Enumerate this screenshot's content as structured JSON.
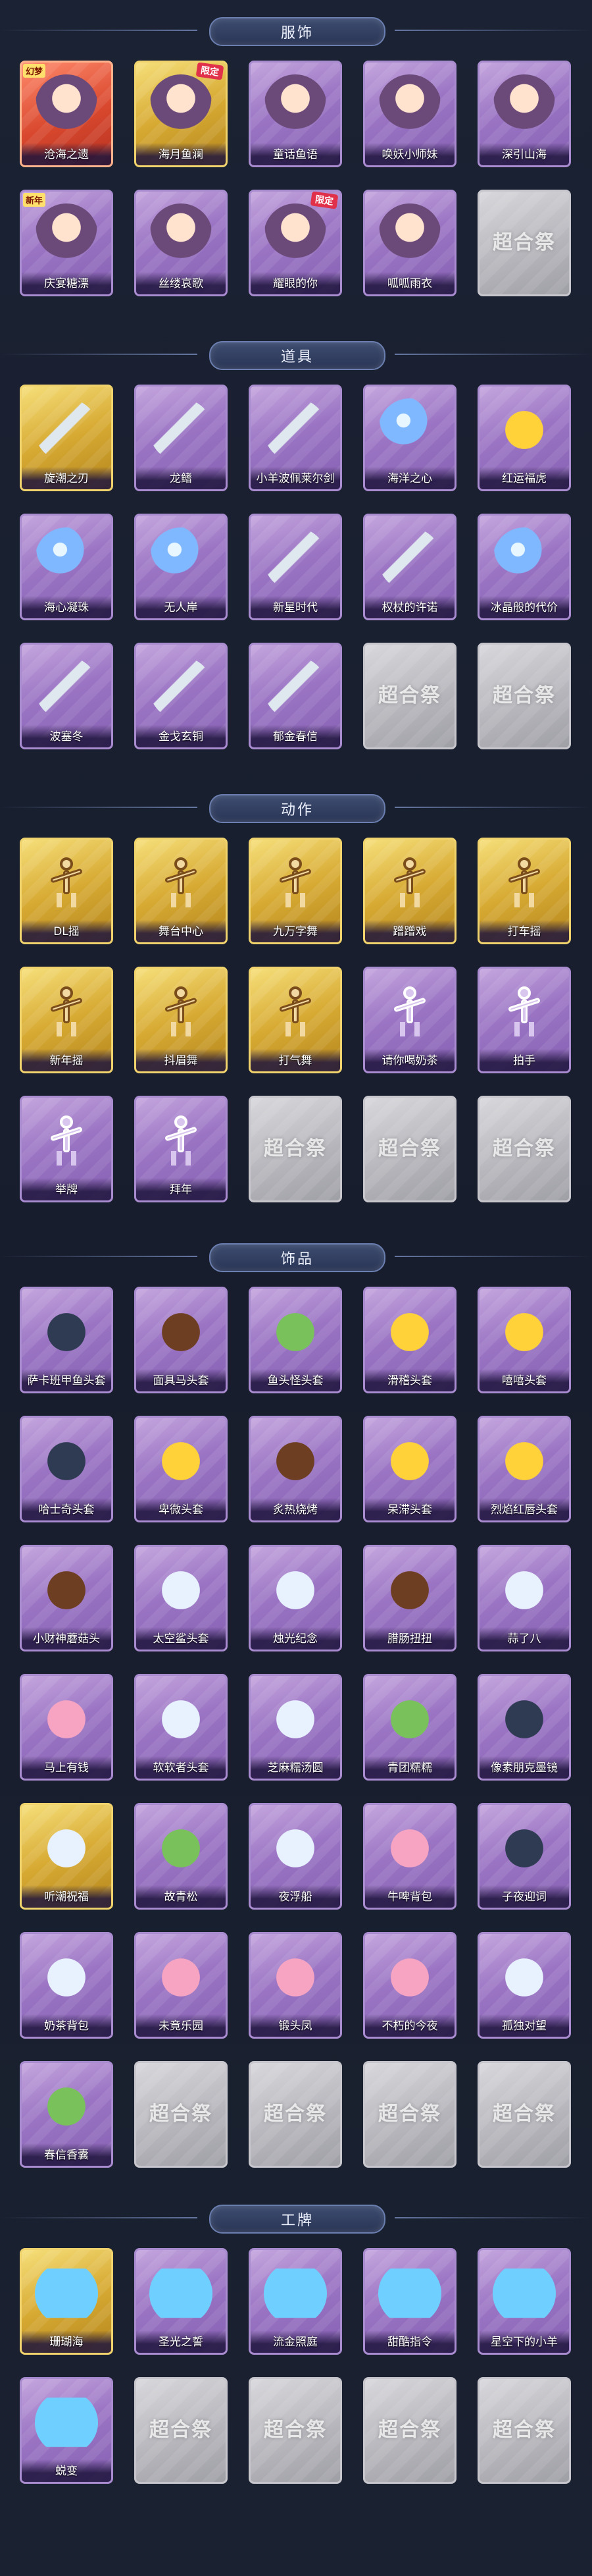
{
  "sections": [
    {
      "title": "服饰",
      "items": [
        {
          "name": "沧海之遗",
          "rarity": "red",
          "art": "portrait",
          "tag": "幻梦",
          "badge": ""
        },
        {
          "name": "海月鱼澜",
          "rarity": "gold",
          "art": "portrait",
          "tag": "",
          "badge": "限定"
        },
        {
          "name": "童话鱼语",
          "rarity": "purple",
          "art": "portrait",
          "tag": "",
          "badge": ""
        },
        {
          "name": "唤妖小师妹",
          "rarity": "purple",
          "art": "portrait",
          "tag": "",
          "badge": ""
        },
        {
          "name": "深引山海",
          "rarity": "purple",
          "art": "portrait",
          "tag": "",
          "badge": ""
        },
        {
          "name": "庆宴糖漂",
          "rarity": "purple",
          "art": "portrait",
          "tag": "新年",
          "badge": ""
        },
        {
          "name": "丝缕哀歌",
          "rarity": "purple",
          "art": "portrait",
          "tag": "",
          "badge": ""
        },
        {
          "name": "耀眼的你",
          "rarity": "purple",
          "art": "portrait",
          "tag": "",
          "badge": "限定"
        },
        {
          "name": "呱呱雨衣",
          "rarity": "purple",
          "art": "portrait",
          "tag": "",
          "badge": ""
        },
        {
          "name": "",
          "rarity": "locked",
          "art": "",
          "tag": "",
          "badge": ""
        }
      ]
    },
    {
      "title": "道具",
      "items": [
        {
          "name": "旋潮之刃",
          "rarity": "gold",
          "art": "tool",
          "tag": "",
          "badge": ""
        },
        {
          "name": "龙鳍",
          "rarity": "purple",
          "art": "tool",
          "tag": "",
          "badge": ""
        },
        {
          "name": "小羊波佩莱尔剑",
          "rarity": "purple",
          "art": "tool",
          "tag": "",
          "badge": ""
        },
        {
          "name": "海洋之心",
          "rarity": "purple",
          "art": "gem",
          "tag": "",
          "badge": ""
        },
        {
          "name": "红运福虎",
          "rarity": "purple",
          "art": "head",
          "tag": "",
          "badge": ""
        },
        {
          "name": "海心凝珠",
          "rarity": "purple",
          "art": "gem",
          "tag": "",
          "badge": ""
        },
        {
          "name": "无人岸",
          "rarity": "purple",
          "art": "gem",
          "tag": "",
          "badge": ""
        },
        {
          "name": "新星时代",
          "rarity": "purple",
          "art": "tool",
          "tag": "",
          "badge": ""
        },
        {
          "name": "权杖的许诺",
          "rarity": "purple",
          "art": "tool",
          "tag": "",
          "badge": ""
        },
        {
          "name": "冰晶般的代价",
          "rarity": "purple",
          "art": "gem",
          "tag": "",
          "badge": ""
        },
        {
          "name": "波塞冬",
          "rarity": "purple",
          "art": "tool",
          "tag": "",
          "badge": ""
        },
        {
          "name": "金戈玄铜",
          "rarity": "purple",
          "art": "tool",
          "tag": "",
          "badge": ""
        },
        {
          "name": "郁金春信",
          "rarity": "purple",
          "art": "tool",
          "tag": "",
          "badge": ""
        },
        {
          "name": "",
          "rarity": "locked",
          "art": "",
          "tag": "",
          "badge": ""
        },
        {
          "name": "",
          "rarity": "locked",
          "art": "",
          "tag": "",
          "badge": ""
        }
      ]
    },
    {
      "title": "动作",
      "items": [
        {
          "name": "DL摇",
          "rarity": "gold",
          "art": "pose",
          "tag": "",
          "badge": ""
        },
        {
          "name": "舞台中心",
          "rarity": "gold",
          "art": "pose",
          "tag": "",
          "badge": ""
        },
        {
          "name": "九万字舞",
          "rarity": "gold",
          "art": "pose",
          "tag": "",
          "badge": ""
        },
        {
          "name": "蹭蹭戏",
          "rarity": "gold",
          "art": "pose",
          "tag": "",
          "badge": ""
        },
        {
          "name": "打车摇",
          "rarity": "gold",
          "art": "pose",
          "tag": "",
          "badge": ""
        },
        {
          "name": "新年摇",
          "rarity": "gold",
          "art": "pose",
          "tag": "",
          "badge": ""
        },
        {
          "name": "抖眉舞",
          "rarity": "gold",
          "art": "pose",
          "tag": "",
          "badge": ""
        },
        {
          "name": "打气舞",
          "rarity": "gold",
          "art": "pose",
          "tag": "",
          "badge": ""
        },
        {
          "name": "请你喝奶茶",
          "rarity": "purple",
          "art": "pose",
          "tag": "",
          "badge": ""
        },
        {
          "name": "拍手",
          "rarity": "purple",
          "art": "pose",
          "tag": "",
          "badge": ""
        },
        {
          "name": "举牌",
          "rarity": "purple",
          "art": "pose",
          "tag": "",
          "badge": ""
        },
        {
          "name": "拜年",
          "rarity": "purple",
          "art": "pose",
          "tag": "",
          "badge": ""
        },
        {
          "name": "",
          "rarity": "locked",
          "art": "",
          "tag": "",
          "badge": ""
        },
        {
          "name": "",
          "rarity": "locked",
          "art": "",
          "tag": "",
          "badge": ""
        },
        {
          "name": "",
          "rarity": "locked",
          "art": "",
          "tag": "",
          "badge": ""
        }
      ]
    },
    {
      "title": "饰品",
      "items": [
        {
          "name": "萨卡班甲鱼头套",
          "rarity": "purple",
          "art": "dark",
          "tag": "",
          "badge": ""
        },
        {
          "name": "面具马头套",
          "rarity": "purple",
          "art": "brown",
          "tag": "",
          "badge": ""
        },
        {
          "name": "鱼头怪头套",
          "rarity": "purple",
          "art": "green",
          "tag": "",
          "badge": ""
        },
        {
          "name": "滑稽头套",
          "rarity": "purple",
          "art": "head",
          "tag": "",
          "badge": ""
        },
        {
          "name": "嘻嘻头套",
          "rarity": "purple",
          "art": "head",
          "tag": "",
          "badge": ""
        },
        {
          "name": "哈士奇头套",
          "rarity": "purple",
          "art": "dark",
          "tag": "",
          "badge": ""
        },
        {
          "name": "卑微头套",
          "rarity": "purple",
          "art": "head",
          "tag": "",
          "badge": ""
        },
        {
          "name": "炙热烧烤",
          "rarity": "purple",
          "art": "brown",
          "tag": "",
          "badge": ""
        },
        {
          "name": "呆滞头套",
          "rarity": "purple",
          "art": "head",
          "tag": "",
          "badge": ""
        },
        {
          "name": "烈焰红唇头套",
          "rarity": "purple",
          "art": "head",
          "tag": "",
          "badge": ""
        },
        {
          "name": "小财神蘑菇头",
          "rarity": "purple",
          "art": "brown",
          "tag": "",
          "badge": ""
        },
        {
          "name": "太空鲨头套",
          "rarity": "purple",
          "art": "cloud",
          "tag": "",
          "badge": ""
        },
        {
          "name": "烛光纪念",
          "rarity": "purple",
          "art": "cloud",
          "tag": "",
          "badge": ""
        },
        {
          "name": "腊肠扭扭",
          "rarity": "purple",
          "art": "brown",
          "tag": "",
          "badge": ""
        },
        {
          "name": "蒜了八",
          "rarity": "purple",
          "art": "cloud",
          "tag": "",
          "badge": ""
        },
        {
          "name": "马上有钱",
          "rarity": "purple",
          "art": "pink",
          "tag": "",
          "badge": ""
        },
        {
          "name": "软软者头套",
          "rarity": "purple",
          "art": "cloud",
          "tag": "",
          "badge": ""
        },
        {
          "name": "芝麻糯汤圆",
          "rarity": "purple",
          "art": "cloud",
          "tag": "",
          "badge": ""
        },
        {
          "name": "青团糯糯",
          "rarity": "purple",
          "art": "green",
          "tag": "",
          "badge": ""
        },
        {
          "name": "像素朋克墨镜",
          "rarity": "purple",
          "art": "dark",
          "tag": "",
          "badge": ""
        },
        {
          "name": "听潮祝福",
          "rarity": "gold",
          "art": "cloud",
          "tag": "",
          "badge": ""
        },
        {
          "name": "故青松",
          "rarity": "purple",
          "art": "green",
          "tag": "",
          "badge": ""
        },
        {
          "name": "夜浮船",
          "rarity": "purple",
          "art": "cloud",
          "tag": "",
          "badge": ""
        },
        {
          "name": "牛啤背包",
          "rarity": "purple",
          "art": "pink",
          "tag": "",
          "badge": ""
        },
        {
          "name": "子夜迎词",
          "rarity": "purple",
          "art": "dark",
          "tag": "",
          "badge": ""
        },
        {
          "name": "奶茶背包",
          "rarity": "purple",
          "art": "cloud",
          "tag": "",
          "badge": ""
        },
        {
          "name": "未竟乐园",
          "rarity": "purple",
          "art": "pink",
          "tag": "",
          "badge": ""
        },
        {
          "name": "锻头凤",
          "rarity": "purple",
          "art": "pink",
          "tag": "",
          "badge": ""
        },
        {
          "name": "不朽的今夜",
          "rarity": "purple",
          "art": "pink",
          "tag": "",
          "badge": ""
        },
        {
          "name": "孤独对望",
          "rarity": "purple",
          "art": "cloud",
          "tag": "",
          "badge": ""
        },
        {
          "name": "春信香囊",
          "rarity": "purple",
          "art": "green",
          "tag": "",
          "badge": ""
        },
        {
          "name": "",
          "rarity": "locked",
          "art": "",
          "tag": "",
          "badge": ""
        },
        {
          "name": "",
          "rarity": "locked",
          "art": "",
          "tag": "",
          "badge": ""
        },
        {
          "name": "",
          "rarity": "locked",
          "art": "",
          "tag": "",
          "badge": ""
        },
        {
          "name": "",
          "rarity": "locked",
          "art": "",
          "tag": "",
          "badge": ""
        }
      ]
    },
    {
      "title": "工牌",
      "items": [
        {
          "name": "珊瑚海",
          "rarity": "gold",
          "art": "card",
          "tag": "",
          "badge": ""
        },
        {
          "name": "圣光之誓",
          "rarity": "purple",
          "art": "card",
          "tag": "",
          "badge": ""
        },
        {
          "name": "流金照庭",
          "rarity": "purple",
          "art": "card",
          "tag": "",
          "badge": ""
        },
        {
          "name": "甜酷指令",
          "rarity": "purple",
          "art": "card",
          "tag": "",
          "badge": ""
        },
        {
          "name": "星空下的小羊",
          "rarity": "purple",
          "art": "card",
          "tag": "",
          "badge": ""
        },
        {
          "name": "蜕变",
          "rarity": "purple",
          "art": "card",
          "tag": "",
          "badge": ""
        },
        {
          "name": "",
          "rarity": "locked",
          "art": "",
          "tag": "",
          "badge": ""
        },
        {
          "name": "",
          "rarity": "locked",
          "art": "",
          "tag": "",
          "badge": ""
        },
        {
          "name": "",
          "rarity": "locked",
          "art": "",
          "tag": "",
          "badge": ""
        },
        {
          "name": "",
          "rarity": "locked",
          "art": "",
          "tag": "",
          "badge": ""
        }
      ]
    }
  ],
  "locked_watermark": "超合祭"
}
